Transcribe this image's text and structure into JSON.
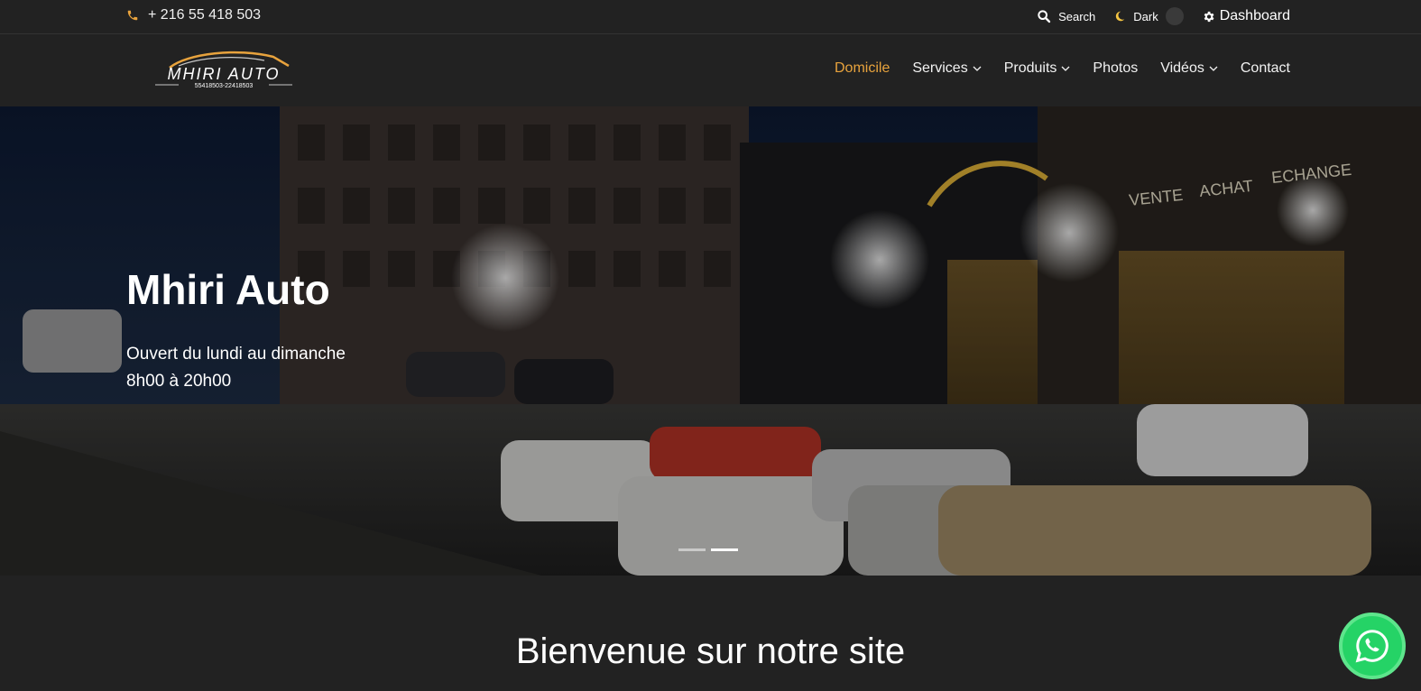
{
  "topbar": {
    "phone": "+ 216 55 418 503",
    "search_label": "Search",
    "dark_label": "Dark",
    "dashboard_label": "Dashboard"
  },
  "brand": {
    "name": "MHIRI AUTO",
    "phones": "55418503-22418503",
    "accent_color": "#e8a33d"
  },
  "nav": {
    "items": [
      {
        "label": "Domicile",
        "active": true,
        "dropdown": false
      },
      {
        "label": "Services",
        "active": false,
        "dropdown": true
      },
      {
        "label": "Produits",
        "active": false,
        "dropdown": true
      },
      {
        "label": "Photos",
        "active": false,
        "dropdown": false
      },
      {
        "label": "Vidéos",
        "active": false,
        "dropdown": true
      },
      {
        "label": "Contact",
        "active": false,
        "dropdown": false
      }
    ]
  },
  "hero": {
    "title": "Mhiri Auto",
    "line1": "Ouvert du lundi au dimanche",
    "line2": "8h00 à 20h00",
    "slides_count": 2,
    "active_slide": 2,
    "sign_words": [
      "VENTE",
      "ACHAT",
      "ECHANGE"
    ]
  },
  "welcome": {
    "heading": "Bienvenue sur notre site"
  },
  "icons": {
    "phone": "phone-icon",
    "search": "search-icon",
    "dark": "moon-icon",
    "dashboard": "gear-icon",
    "whatsapp": "whatsapp-icon"
  }
}
